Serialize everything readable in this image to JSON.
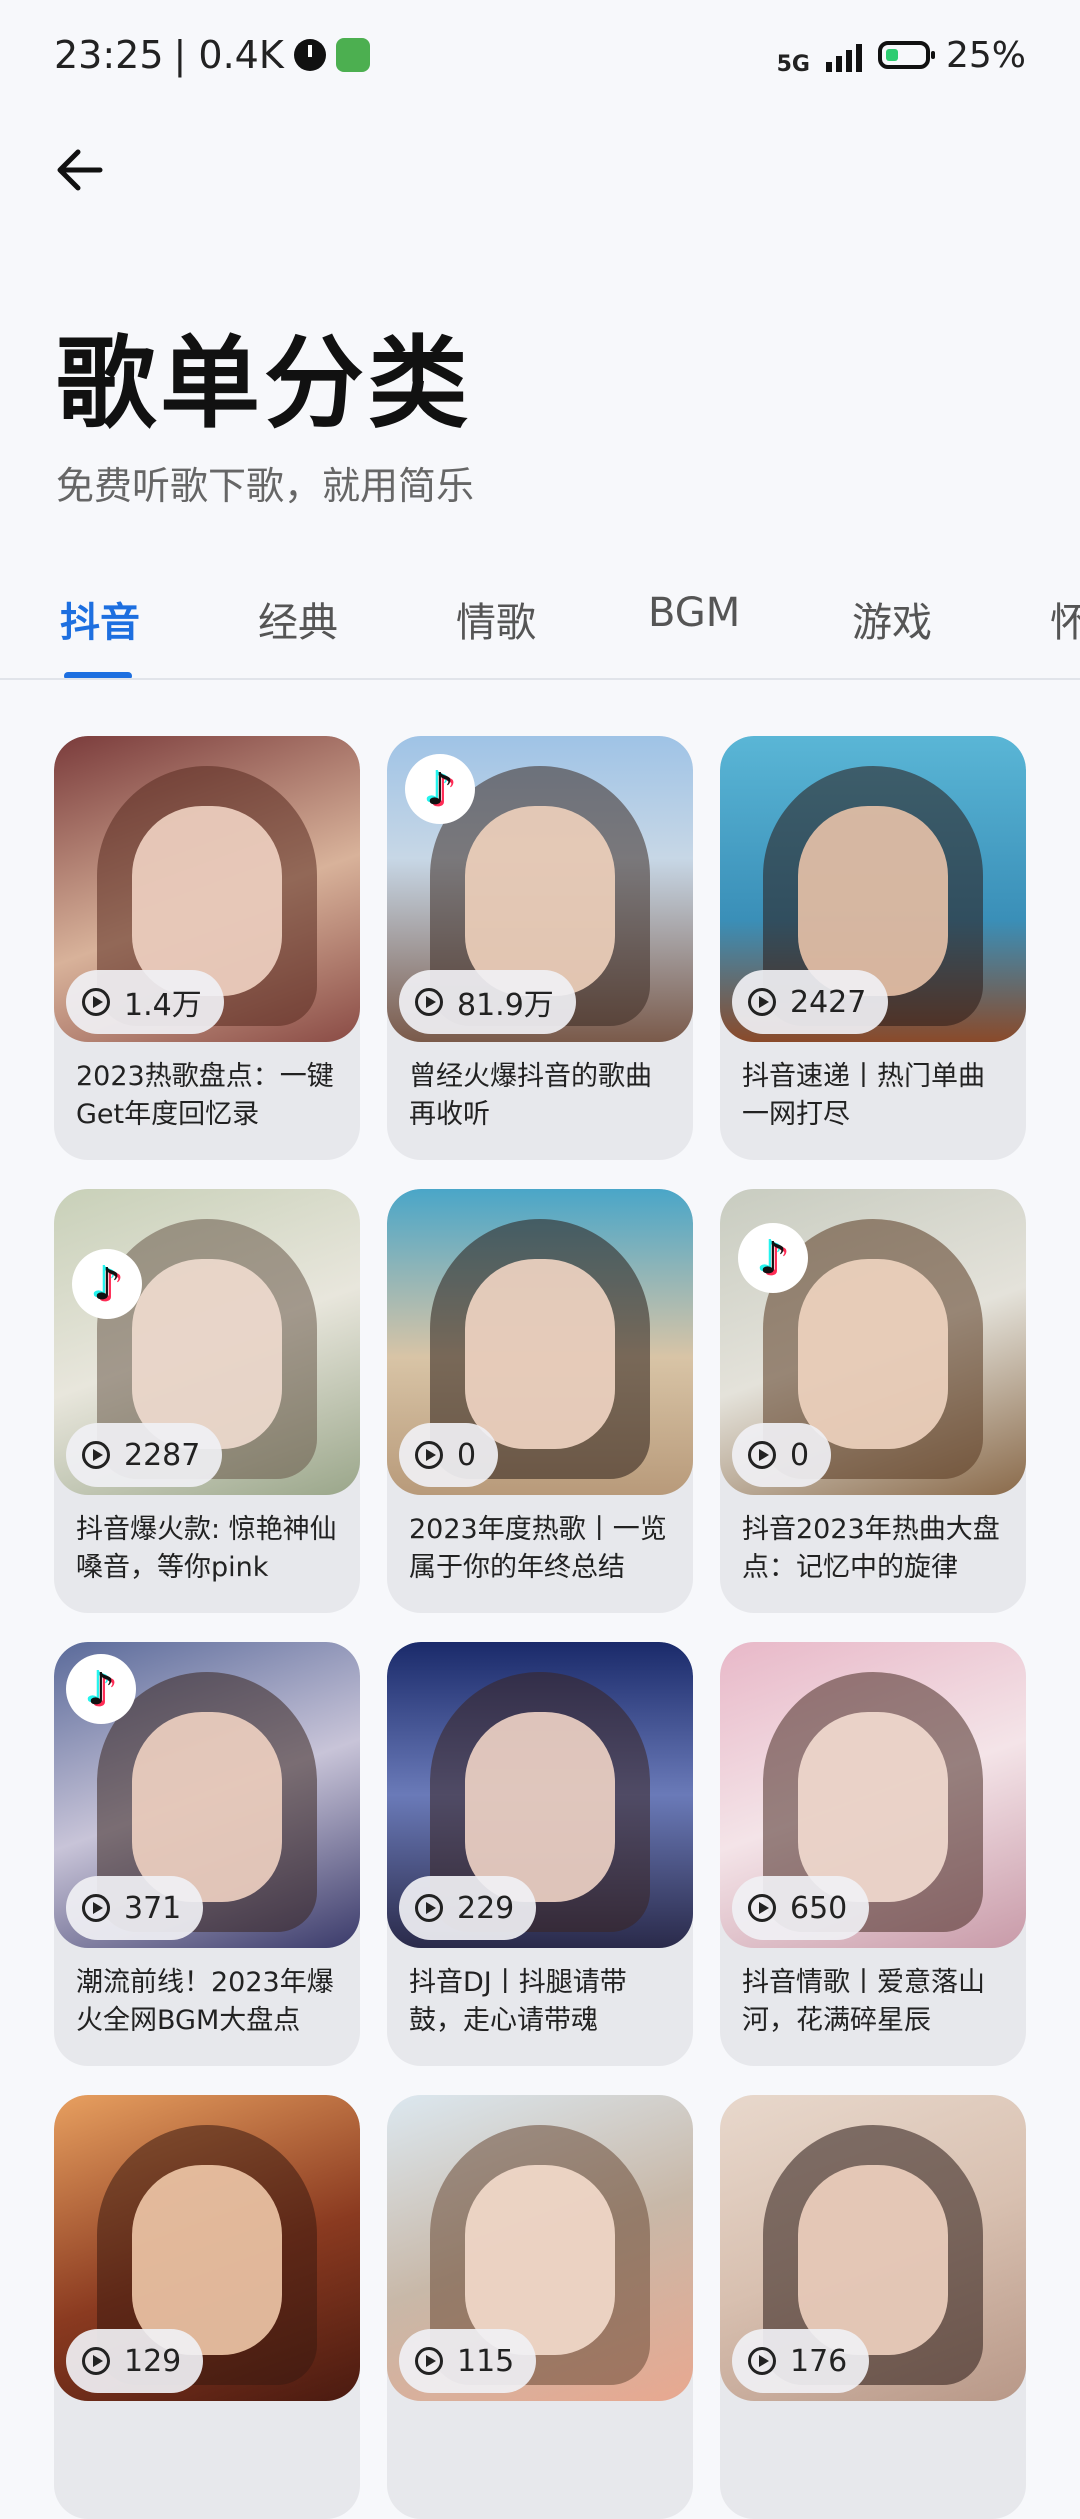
{
  "status_bar": {
    "time": "23:25",
    "network_speed": "| 0.4K",
    "network_type": "5G",
    "battery": "25%"
  },
  "page": {
    "title": "歌单分类",
    "subtitle": "免费听歌下歌，就用简乐"
  },
  "tabs": [
    {
      "label": "抖音",
      "active": true
    },
    {
      "label": "经典"
    },
    {
      "label": "情歌"
    },
    {
      "label": "BGM"
    },
    {
      "label": "游戏"
    },
    {
      "label": "怀"
    }
  ],
  "playlists": [
    {
      "plays": "1.4万",
      "title": "2023热歌盘点：一键Get年度回忆录",
      "tiktok": false
    },
    {
      "plays": "81.9万",
      "title": "曾经火爆抖音的歌曲再收听",
      "tiktok": true
    },
    {
      "plays": "2427",
      "title": "抖音速递丨热门单曲一网打尽",
      "tiktok": false
    },
    {
      "plays": "2287",
      "title": "抖音爆火款: 惊艳神仙嗓音，等你pink",
      "tiktok": true
    },
    {
      "plays": "0",
      "title": "2023年度热歌丨一览属于你的年终总结",
      "tiktok": false
    },
    {
      "plays": "0",
      "title": "抖音2023年热曲大盘点：记忆中的旋律",
      "tiktok": true
    },
    {
      "plays": "371",
      "title": "潮流前线！2023年爆火全网BGM大盘点",
      "tiktok": true
    },
    {
      "plays": "229",
      "title": "抖音DJ丨抖腿请带鼓，走心请带魂",
      "tiktok": false
    },
    {
      "plays": "650",
      "title": "抖音情歌丨爱意落山河，花满碎星辰",
      "tiktok": false
    },
    {
      "plays": "129",
      "title": "",
      "tiktok": false
    },
    {
      "plays": "115",
      "title": "",
      "tiktok": false
    },
    {
      "plays": "176",
      "title": "",
      "tiktok": false
    }
  ],
  "colors": {
    "accent": "#1d6fe0",
    "card_bg": "#e7e8ec",
    "page_bg": "#f7f8fb"
  }
}
